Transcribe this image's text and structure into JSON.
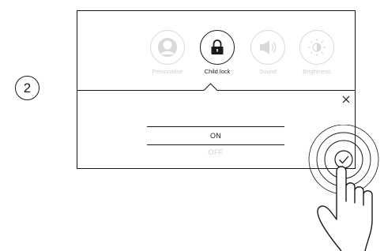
{
  "step": {
    "number": "2"
  },
  "menu": {
    "items": [
      {
        "label": "Personalise",
        "icon": "person-icon",
        "active": false
      },
      {
        "label": "Child lock",
        "icon": "padlock-icon",
        "active": true
      },
      {
        "label": "Sound",
        "icon": "speaker-icon",
        "active": false
      },
      {
        "label": "Brightness",
        "icon": "brightness-icon",
        "active": false
      }
    ]
  },
  "options": {
    "selected": "ON",
    "other": "OFF"
  },
  "icons": {
    "close": "close-icon",
    "confirm": "checkmark-icon",
    "hand": "pointing-hand-icon"
  },
  "colors": {
    "active": "#1a1a1a",
    "inactive": "#cfcfcf"
  }
}
